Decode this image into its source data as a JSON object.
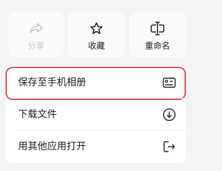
{
  "actions": [
    {
      "label": "分享",
      "icon": "share-icon",
      "enabled": false
    },
    {
      "label": "收藏",
      "icon": "star-icon",
      "enabled": true
    },
    {
      "label": "重命名",
      "icon": "rename-cursor-icon",
      "enabled": true
    }
  ],
  "menu": {
    "items": [
      {
        "label": "保存至手机相册",
        "icon": "album-image-icon",
        "highlighted": true
      },
      {
        "label": "下载文件",
        "icon": "download-circle-icon",
        "highlighted": false
      },
      {
        "label": "用其他应用打开",
        "icon": "open-external-icon",
        "highlighted": false
      }
    ]
  },
  "colors": {
    "background": "#f3f3f4",
    "tile": "#fafafa",
    "card": "#ffffff",
    "highlight": "#e0514f",
    "disabled_text": "#c7c7c7"
  }
}
